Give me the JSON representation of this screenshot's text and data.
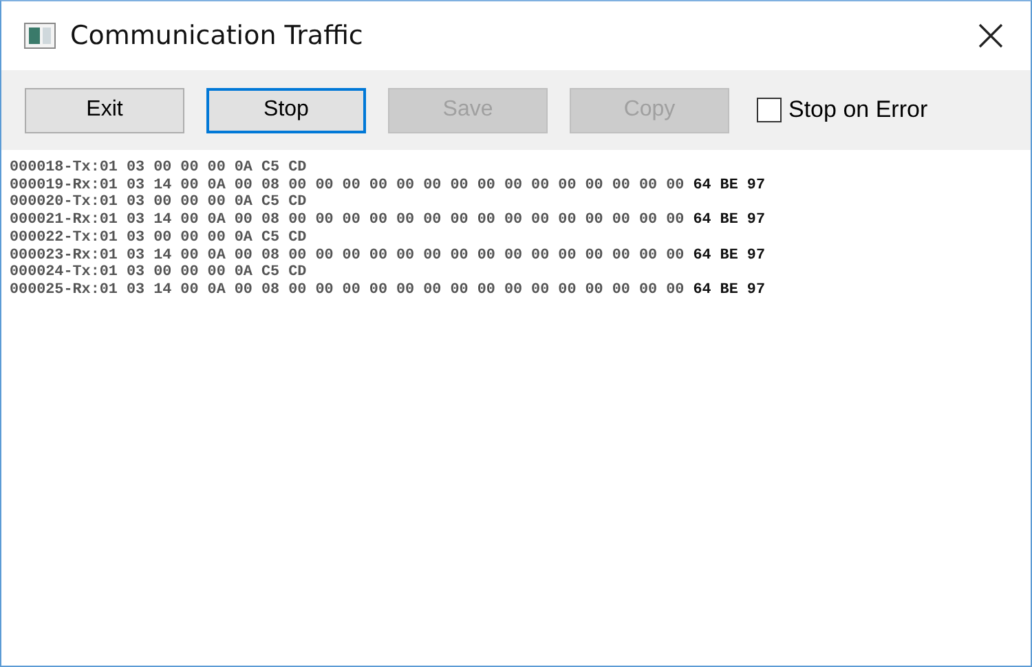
{
  "window": {
    "title": "Communication Traffic"
  },
  "buttons": [
    {
      "label": "Exit",
      "disabled": false,
      "focused": false
    },
    {
      "label": "Stop",
      "disabled": false,
      "focused": true
    },
    {
      "label": "Save",
      "disabled": true,
      "focused": false
    },
    {
      "label": "Copy",
      "disabled": true,
      "focused": false
    }
  ],
  "stop_on_error": {
    "label": "Stop on Error",
    "checked": false
  },
  "log_lines": [
    "000018-Tx:01 03 00 00 00 0A C5 CD",
    "000019-Rx:01 03 14 00 0A 00 08 00 00 00 00 00 00 00 00 00 00 00 00 00 00 00 **64 BE 97**",
    "000020-Tx:01 03 00 00 00 0A C5 CD",
    "000021-Rx:01 03 14 00 0A 00 08 00 00 00 00 00 00 00 00 00 00 00 00 00 00 00 **64 BE 97**",
    "000022-Tx:01 03 00 00 00 0A C5 CD",
    "000023-Rx:01 03 14 00 0A 00 08 00 00 00 00 00 00 00 00 00 00 00 00 00 00 00 **64 BE 97**",
    "000024-Tx:01 03 00 00 00 0A C5 CD",
    "000025-Rx:01 03 14 00 0A 00 08 00 00 00 00 00 00 00 00 00 00 00 00 00 00 00 **64 BE 97**"
  ]
}
